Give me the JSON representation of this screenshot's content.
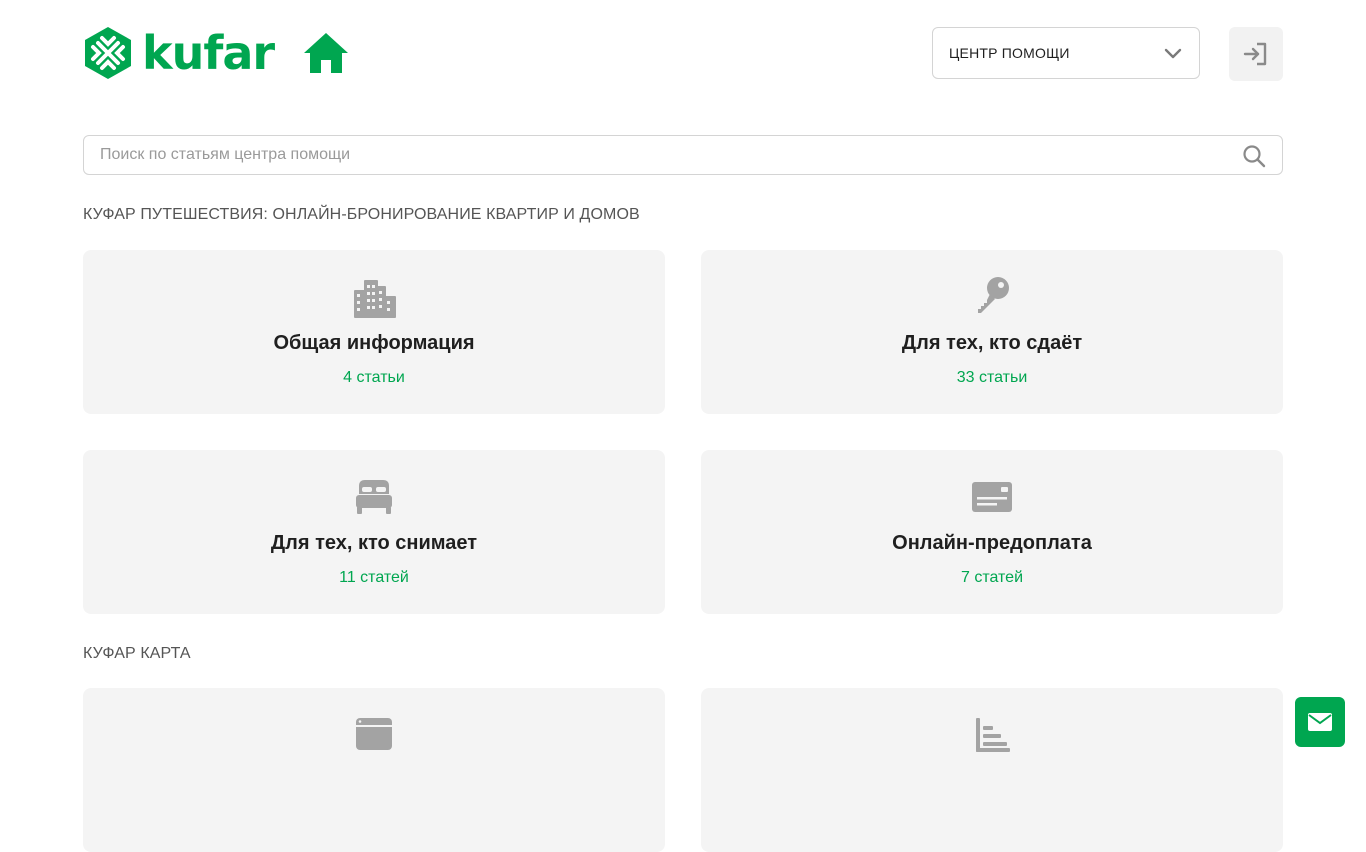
{
  "header": {
    "logo_text": "kufar",
    "help_center_label": "ЦЕНТР ПОМОЩИ"
  },
  "search": {
    "placeholder": "Поиск по статьям центра помощи",
    "value": ""
  },
  "sections": [
    {
      "title": "КУФАР ПУТЕШЕСТВИЯ: ОНЛАЙН-БРОНИРОВАНИЕ КВАРТИР И ДОМОВ",
      "cards": [
        {
          "title": "Общая информация",
          "count": "4 статьи",
          "icon": "city-buildings-icon"
        },
        {
          "title": "Для тех, кто сдаёт",
          "count": "33 статьи",
          "icon": "key-icon"
        },
        {
          "title": "Для тех, кто снимает",
          "count": "11 статей",
          "icon": "bed-icon"
        },
        {
          "title": "Онлайн-предоплата",
          "count": "7 статей",
          "icon": "payment-card-icon"
        }
      ]
    },
    {
      "title": "КУФАР КАРТА",
      "cards": [
        {
          "title": "",
          "count": "",
          "icon": "browser-window-icon"
        },
        {
          "title": "",
          "count": "",
          "icon": "bar-list-icon"
        }
      ]
    }
  ],
  "colors": {
    "brand_green": "#00a650",
    "card_bg": "#f4f4f4",
    "icon_gray": "#a3a3a3",
    "text_dark": "#1f1f1f"
  }
}
